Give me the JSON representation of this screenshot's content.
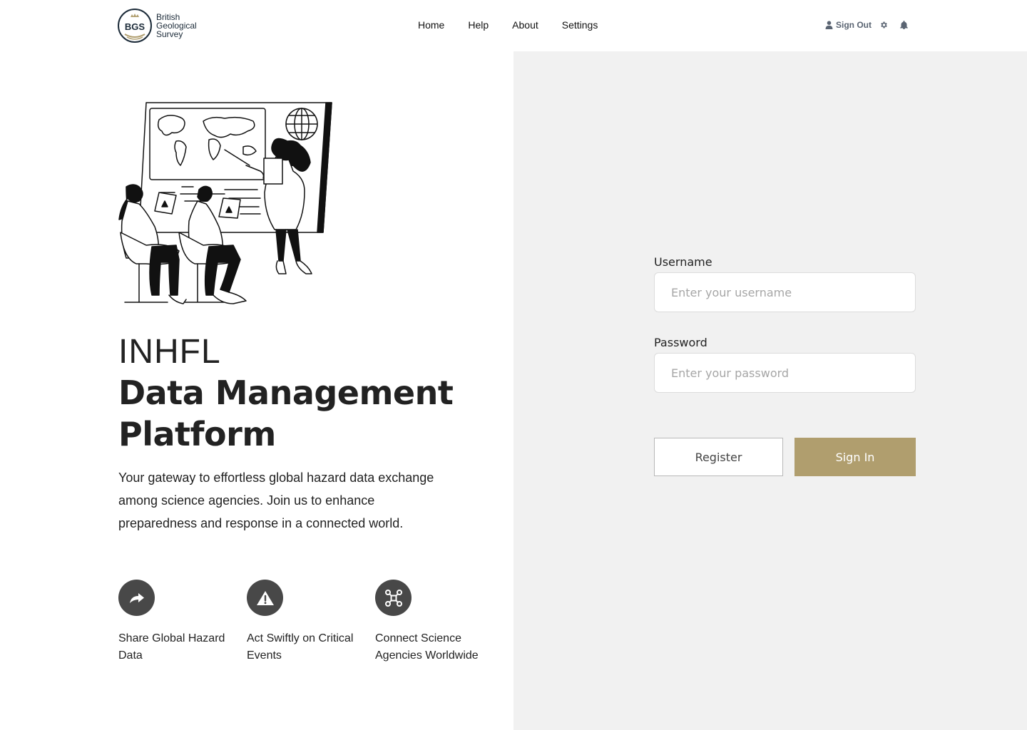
{
  "header": {
    "logo": {
      "abbr": "BGS",
      "line1": "British",
      "line2": "Geological",
      "line3": "Survey"
    },
    "nav": [
      {
        "label": "Home"
      },
      {
        "label": "Help"
      },
      {
        "label": "About"
      },
      {
        "label": "Settings"
      }
    ],
    "user": {
      "sign_out_label": "Sign Out",
      "icons": [
        "user-icon",
        "gear-icon",
        "bell-icon"
      ]
    }
  },
  "hero": {
    "title_light": "INHFL",
    "title_bold": "Data Management Platform",
    "description": "Your gateway to effortless global hazard data exchange among science agencies. Join us to enhance preparedness and response in a connected world.",
    "features": [
      {
        "icon": "share-arrow-icon",
        "label": "Share Global Hazard Data"
      },
      {
        "icon": "warning-icon",
        "label": "Act Swiftly on Critical Events"
      },
      {
        "icon": "network-icon",
        "label": "Connect Science Agencies Worldwide"
      }
    ]
  },
  "login_form": {
    "username_label": "Username",
    "username_placeholder": "Enter your username",
    "username_value": "",
    "password_label": "Password",
    "password_placeholder": "Enter your password",
    "password_value": "",
    "register_label": "Register",
    "signin_label": "Sign In"
  },
  "colors": {
    "accent": "#b09e6e",
    "panel_bg": "#f1f1f1",
    "icon_bg": "#484848",
    "text": "#222222",
    "logo_navy": "#1c2b39"
  }
}
